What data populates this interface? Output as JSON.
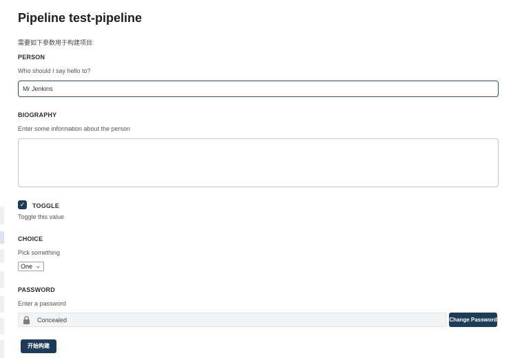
{
  "page": {
    "title": "Pipeline test-pipeline",
    "intro": "需要如下参数用于构建项目:"
  },
  "person": {
    "label": "PERSON",
    "help": "Who should I say hello to?",
    "value": "Mr Jenkins"
  },
  "biography": {
    "label": "BIOGRAPHY",
    "help": "Enter some information about the person",
    "value": ""
  },
  "toggle": {
    "label": "TOGGLE",
    "help": "Toggle this value",
    "checked": true,
    "check_glyph": "✓"
  },
  "choice": {
    "label": "CHOICE",
    "help": "Pick something",
    "selected": "One",
    "chevron": "⌄"
  },
  "password": {
    "label": "PASSWORD",
    "help": "Enter a password",
    "value": "Concealed",
    "icon": "lock-icon",
    "change_label": "Change Password"
  },
  "actions": {
    "build_label": "开始构建"
  },
  "colors": {
    "accent": "#1f3b5a",
    "input_border_focus": "#2f4a66"
  }
}
